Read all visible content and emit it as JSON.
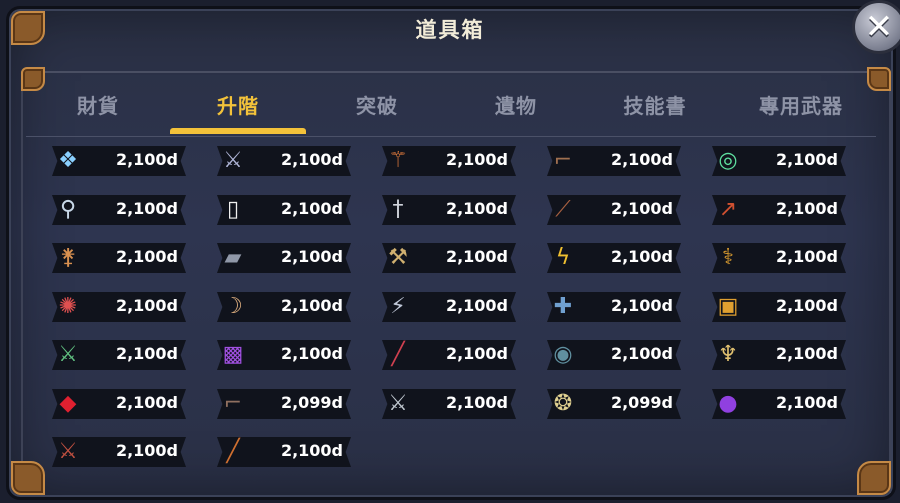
{
  "title": "道具箱",
  "close_label": "✕",
  "tabs": [
    {
      "label": "財貨",
      "active": false
    },
    {
      "label": "升階",
      "active": true
    },
    {
      "label": "突破",
      "active": false
    },
    {
      "label": "遺物",
      "active": false
    },
    {
      "label": "技能書",
      "active": false
    },
    {
      "label": "專用武器",
      "active": false
    }
  ],
  "items": [
    [
      {
        "icon": "crystal-pendant-icon",
        "glyph": "❖",
        "color": "#8ad0ff",
        "price": "2,100d"
      },
      {
        "icon": "twin-daggers-icon",
        "glyph": "⚔",
        "color": "#b0b6d8",
        "price": "2,100d"
      },
      {
        "icon": "fire-staff-icon",
        "glyph": "⚚",
        "color": "#e07a3c",
        "price": "2,100d"
      },
      {
        "icon": "pistol-icon",
        "glyph": "⌐",
        "color": "#a07050",
        "price": "2,100d"
      },
      {
        "icon": "emerald-ring-icon",
        "glyph": "◎",
        "color": "#5fe0a0",
        "price": "2,100d"
      }
    ],
    [
      {
        "icon": "blue-knife-icon",
        "glyph": "⚲",
        "color": "#c8d8e8",
        "price": "2,100d"
      },
      {
        "icon": "card-icon",
        "glyph": "▯",
        "color": "#f0f0f0",
        "price": "2,100d"
      },
      {
        "icon": "broadsword-icon",
        "glyph": "†",
        "color": "#d0d4dc",
        "price": "2,100d"
      },
      {
        "icon": "rifle-icon",
        "glyph": "⟋",
        "color": "#a86040",
        "price": "2,100d"
      },
      {
        "icon": "red-spear-icon",
        "glyph": "↗",
        "color": "#d05030",
        "price": "2,100d"
      }
    ],
    [
      {
        "icon": "spiked-wand-icon",
        "glyph": "⚵",
        "color": "#d89050",
        "price": "2,100d"
      },
      {
        "icon": "gauntlet-icon",
        "glyph": "▰",
        "color": "#9098a8",
        "price": "2,100d"
      },
      {
        "icon": "crossed-axes-icon",
        "glyph": "⚒",
        "color": "#d0b070",
        "price": "2,100d"
      },
      {
        "icon": "lightning-bolt-icon",
        "glyph": "ϟ",
        "color": "#f0c030",
        "price": "2,100d"
      },
      {
        "icon": "jeweled-scepter-icon",
        "glyph": "⚕",
        "color": "#e0a030",
        "price": "2,100d"
      }
    ],
    [
      {
        "icon": "ruby-scepter-icon",
        "glyph": "✺",
        "color": "#e05050",
        "price": "2,100d"
      },
      {
        "icon": "bow-icon",
        "glyph": "☽",
        "color": "#e0b080",
        "price": "2,100d"
      },
      {
        "icon": "syringe-icon",
        "glyph": "⚡",
        "color": "#c0c8d8",
        "price": "2,100d"
      },
      {
        "icon": "crossbow-icon",
        "glyph": "✚",
        "color": "#70a0d0",
        "price": "2,100d"
      },
      {
        "icon": "golden-barrel-icon",
        "glyph": "▣",
        "color": "#e0a030",
        "price": "2,100d"
      }
    ],
    [
      {
        "icon": "green-cleaver-icon",
        "glyph": "⚔",
        "color": "#60c080",
        "price": "2,100d"
      },
      {
        "icon": "purple-tablet-icon",
        "glyph": "▩",
        "color": "#a050e0",
        "price": "2,100d"
      },
      {
        "icon": "crimson-blade-icon",
        "glyph": "╱",
        "color": "#d04050",
        "price": "2,100d"
      },
      {
        "icon": "round-shield-icon",
        "glyph": "◉",
        "color": "#6090a0",
        "price": "2,100d"
      },
      {
        "icon": "golden-dagger-icon",
        "glyph": "♆",
        "color": "#e0c070",
        "price": "2,100d"
      }
    ],
    [
      {
        "icon": "red-banner-icon",
        "glyph": "◆",
        "color": "#e02030",
        "price": "2,100d"
      },
      {
        "icon": "tommy-gun-icon",
        "glyph": "⌐",
        "color": "#907060",
        "price": "2,099d"
      },
      {
        "icon": "serrated-sword-icon",
        "glyph": "⚔",
        "color": "#c0c8d0",
        "price": "2,100d"
      },
      {
        "icon": "winged-crest-icon",
        "glyph": "❂",
        "color": "#e0d090",
        "price": "2,099d"
      },
      {
        "icon": "purple-orb-icon",
        "glyph": "●",
        "color": "#9040e0",
        "price": "2,100d"
      }
    ],
    [
      {
        "icon": "halberd-icon",
        "glyph": "⚔",
        "color": "#c05040",
        "price": "2,100d"
      },
      {
        "icon": "long-staff-icon",
        "glyph": "╱",
        "color": "#d07030",
        "price": "2,100d"
      }
    ]
  ]
}
